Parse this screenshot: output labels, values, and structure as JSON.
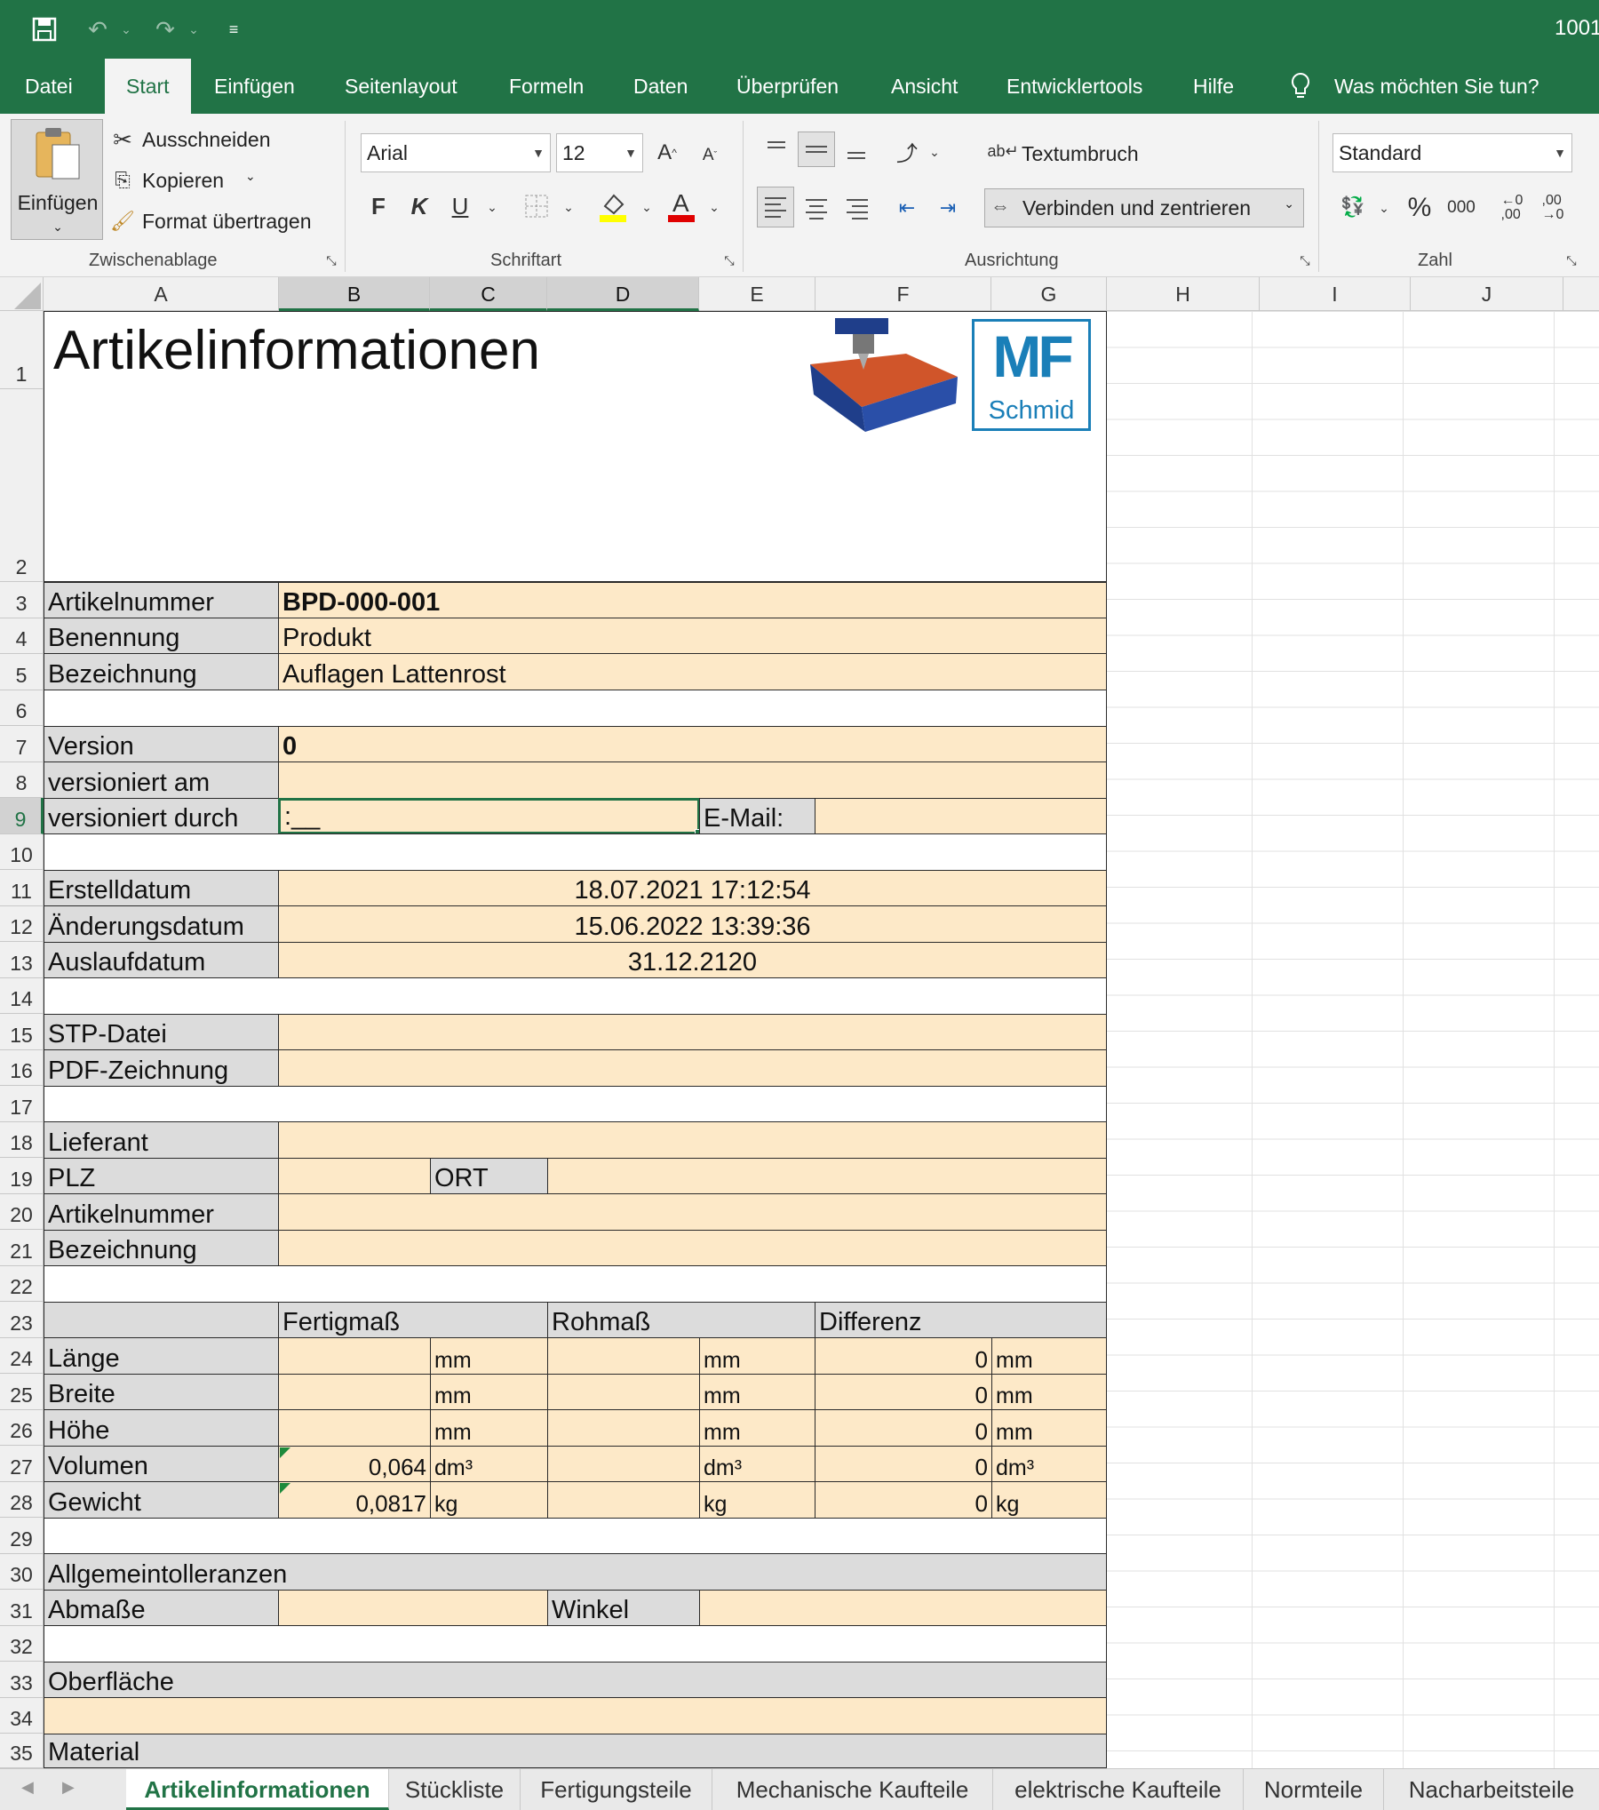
{
  "titlebar": {
    "title": "1001"
  },
  "menu": {
    "items": [
      "Datei",
      "Start",
      "Einfügen",
      "Seitenlayout",
      "Formeln",
      "Daten",
      "Überprüfen",
      "Ansicht",
      "Entwicklertools",
      "Hilfe"
    ],
    "tell_me": "Was möchten Sie tun?"
  },
  "ribbon": {
    "paste": "Einfügen",
    "cut": "Ausschneiden",
    "copy": "Kopieren",
    "format_painter": "Format übertragen",
    "group_clipboard": "Zwischenablage",
    "font_name": "Arial",
    "font_size": "12",
    "bold": "F",
    "italic": "K",
    "underline": "U",
    "group_font": "Schriftart",
    "wrap_text": "Textumbruch",
    "merge_center": "Verbinden und zentrieren",
    "group_alignment": "Ausrichtung",
    "number_format": "Standard",
    "percent": "%",
    "thousands": "000",
    "group_number": "Zahl"
  },
  "columns": [
    "A",
    "B",
    "C",
    "D",
    "E",
    "F",
    "G",
    "H",
    "I",
    "J"
  ],
  "rows": [
    "1",
    "2",
    "3",
    "4",
    "5",
    "6",
    "7",
    "8",
    "9",
    "10",
    "11",
    "12",
    "13",
    "14",
    "15",
    "16",
    "17",
    "18",
    "19",
    "20",
    "21",
    "22",
    "23",
    "24",
    "25",
    "26",
    "27",
    "28",
    "29",
    "30",
    "31",
    "32",
    "33",
    "34",
    "35"
  ],
  "sheet": {
    "title": "Artikelinformationen",
    "logo_text": "MF",
    "logo_sub": "Schmid",
    "artikelnummer_label": "Artikelnummer",
    "artikelnummer": "BPD-000-001",
    "benennung_label": "Benennung",
    "benennung": "Produkt",
    "bezeichnung_label": "Bezeichnung",
    "bezeichnung": "Auflagen Lattenrost",
    "version_label": "Version",
    "version": "0",
    "versioniert_am_label": "versioniert am",
    "versioniert_durch_label": "versioniert durch",
    "versioniert_durch": ":__",
    "email_label": "E-Mail:",
    "erstelldatum_label": "Erstelldatum",
    "erstelldatum": "18.07.2021 17:12:54",
    "aenderungsdatum_label": "Änderungsdatum",
    "aenderungsdatum": "15.06.2022 13:39:36",
    "auslaufdatum_label": "Auslaufdatum",
    "auslaufdatum": "31.12.2120",
    "stp_label": "STP-Datei",
    "pdf_label": "PDF-Zeichnung",
    "lieferant_label": "Lieferant",
    "plz_label": "PLZ",
    "ort_label": "ORT",
    "artikelnummer2_label": "Artikelnummer",
    "bezeichnung2_label": "Bezeichnung",
    "fertigmass": "Fertigmaß",
    "rohmass": "Rohmaß",
    "differenz": "Differenz",
    "laenge_label": "Länge",
    "breite_label": "Breite",
    "hoehe_label": "Höhe",
    "volumen_label": "Volumen",
    "gewicht_label": "Gewicht",
    "unit_mm": "mm",
    "unit_dm3": "dm³",
    "unit_kg": "kg",
    "volumen_fertig": "0,064",
    "gewicht_fertig": "0,0817",
    "diff_zero": "0",
    "allgemeintoleranzen_label": "Allgemeintolleranzen",
    "abmasse_label": "Abmaße",
    "winkel_label": "Winkel",
    "oberflaeche_label": "Oberfläche",
    "material_label": "Material"
  },
  "tabs": [
    "Artikelinformationen",
    "Stückliste",
    "Fertigungsteile",
    "Mechanische Kaufteile",
    "elektrische Kaufteile",
    "Normteile",
    "Nacharbeitsteile"
  ],
  "colors": {
    "excel_green": "#217346",
    "label_gray": "#dcdcdc",
    "value_tan": "#fde9c8",
    "logo_blue": "#1a7fb8"
  }
}
